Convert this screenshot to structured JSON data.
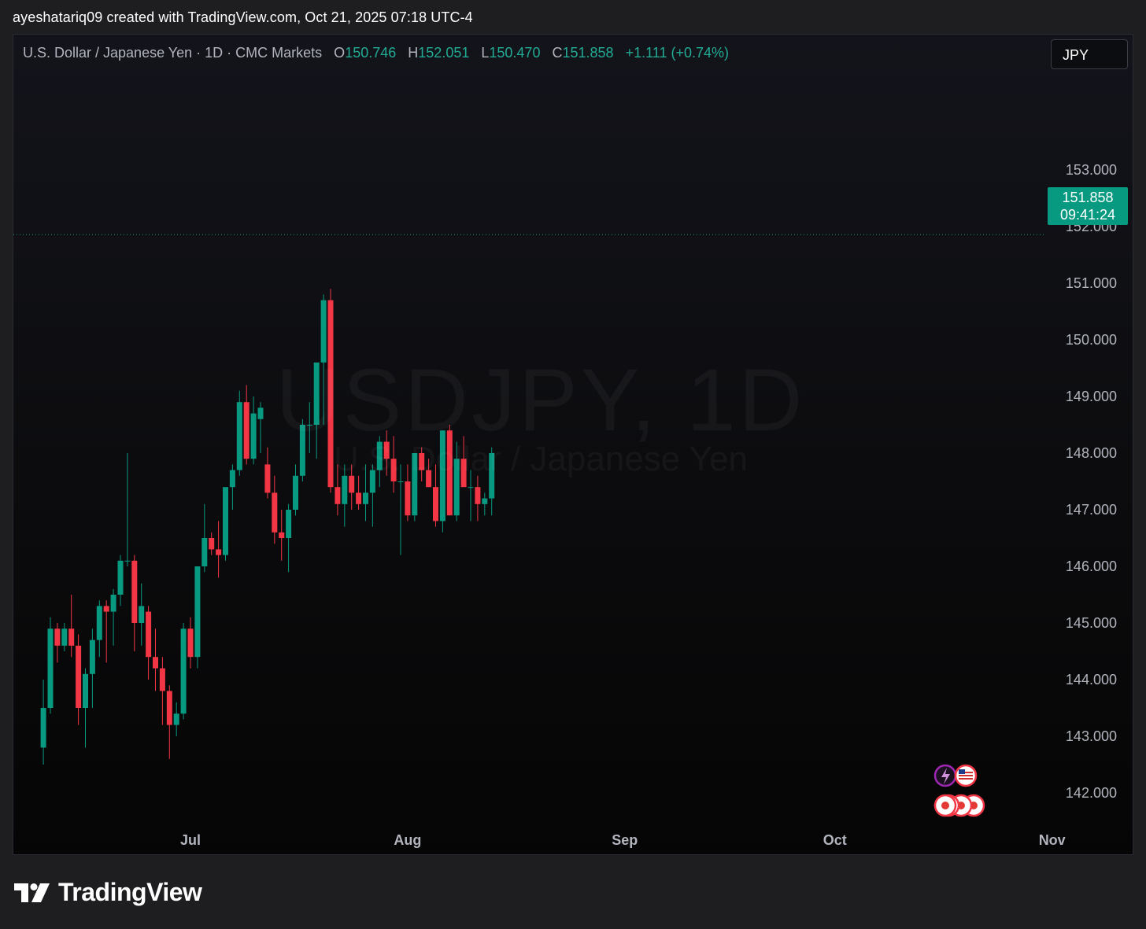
{
  "header": {
    "credit": "ayeshatariq09 created with TradingView.com, Oct 21, 2025 07:18 UTC-4"
  },
  "legend": {
    "symbol": "U.S. Dollar / Japanese Yen · 1D · CMC Markets",
    "open_label": "O",
    "open": "150.746",
    "high_label": "H",
    "high": "152.051",
    "low_label": "L",
    "low": "150.470",
    "close_label": "C",
    "close": "151.858",
    "change": "+1.111 (+0.74%)"
  },
  "currency_button": {
    "label": "JPY"
  },
  "watermark": {
    "symbol": "USDJPY, 1D",
    "name": "U.S. Dollar / Japanese Yen"
  },
  "last_price": {
    "price": "151.858",
    "countdown": "09:41:24"
  },
  "footer": {
    "brand": "TradingView"
  },
  "colors": {
    "up": "#089981",
    "down": "#f23645",
    "background": "#0b0b0d",
    "axis_text": "#b2b5be"
  },
  "icons": [
    "lightning-event-icon",
    "us-flag-icon",
    "japan-flag-icon"
  ],
  "chart_data": {
    "type": "candlestick",
    "title": "U.S. Dollar / Japanese Yen · 1D · CMC Markets",
    "x_ticks": [
      "Jul",
      "Aug",
      "Sep",
      "Oct",
      "Nov"
    ],
    "y_ticks": [
      "142.000",
      "143.000",
      "144.000",
      "145.000",
      "146.000",
      "147.000",
      "148.000",
      "149.000",
      "150.000",
      "151.000",
      "152.000",
      "153.000"
    ],
    "ylim": [
      141.5,
      154.0
    ],
    "x_range_days": [
      -21,
      44
    ],
    "x_tick_days": [
      0,
      31,
      62,
      92,
      123
    ],
    "grid": false,
    "candles": [
      {
        "d": -21,
        "o": 142.8,
        "h": 144.0,
        "l": 142.5,
        "c": 143.5
      },
      {
        "d": -20,
        "o": 143.5,
        "h": 145.1,
        "l": 143.4,
        "c": 144.9
      },
      {
        "d": -19,
        "o": 144.9,
        "h": 145.0,
        "l": 144.3,
        "c": 144.6
      },
      {
        "d": -18,
        "o": 144.6,
        "h": 145.0,
        "l": 144.5,
        "c": 144.9
      },
      {
        "d": -17,
        "o": 144.9,
        "h": 145.5,
        "l": 144.4,
        "c": 144.6
      },
      {
        "d": -16,
        "o": 144.6,
        "h": 144.8,
        "l": 143.2,
        "c": 143.5
      },
      {
        "d": -15,
        "o": 143.5,
        "h": 144.2,
        "l": 142.8,
        "c": 144.1
      },
      {
        "d": -14,
        "o": 144.1,
        "h": 144.9,
        "l": 143.5,
        "c": 144.7
      },
      {
        "d": -13,
        "o": 144.7,
        "h": 145.4,
        "l": 144.4,
        "c": 145.3
      },
      {
        "d": -12,
        "o": 145.3,
        "h": 145.4,
        "l": 144.3,
        "c": 145.2
      },
      {
        "d": -11,
        "o": 145.2,
        "h": 145.6,
        "l": 144.6,
        "c": 145.5
      },
      {
        "d": -10,
        "o": 145.5,
        "h": 146.2,
        "l": 145.3,
        "c": 146.1
      },
      {
        "d": -9,
        "o": 146.1,
        "h": 148.0,
        "l": 146.0,
        "c": 146.1
      },
      {
        "d": -8,
        "o": 146.1,
        "h": 146.2,
        "l": 144.5,
        "c": 145.0
      },
      {
        "d": -7,
        "o": 145.0,
        "h": 145.7,
        "l": 144.6,
        "c": 145.3
      },
      {
        "d": -6,
        "o": 145.2,
        "h": 145.3,
        "l": 144.0,
        "c": 144.4
      },
      {
        "d": -5,
        "o": 144.4,
        "h": 144.9,
        "l": 143.8,
        "c": 144.2
      },
      {
        "d": -4,
        "o": 144.2,
        "h": 144.4,
        "l": 143.2,
        "c": 143.8
      },
      {
        "d": -3,
        "o": 143.8,
        "h": 143.9,
        "l": 142.6,
        "c": 143.2
      },
      {
        "d": -2,
        "o": 143.2,
        "h": 143.6,
        "l": 143.0,
        "c": 143.4
      },
      {
        "d": -1,
        "o": 143.4,
        "h": 145.0,
        "l": 143.3,
        "c": 144.9
      },
      {
        "d": 0,
        "o": 144.9,
        "h": 145.1,
        "l": 144.2,
        "c": 144.4
      },
      {
        "d": 1,
        "o": 144.4,
        "h": 146.0,
        "l": 144.2,
        "c": 146.0
      },
      {
        "d": 2,
        "o": 146.0,
        "h": 147.1,
        "l": 145.9,
        "c": 146.5
      },
      {
        "d": 3,
        "o": 146.5,
        "h": 146.6,
        "l": 146.2,
        "c": 146.3
      },
      {
        "d": 4,
        "o": 146.3,
        "h": 146.8,
        "l": 145.8,
        "c": 146.2
      },
      {
        "d": 5,
        "o": 146.2,
        "h": 147.4,
        "l": 146.1,
        "c": 147.4
      },
      {
        "d": 6,
        "o": 147.4,
        "h": 147.8,
        "l": 147.0,
        "c": 147.7
      },
      {
        "d": 7,
        "o": 147.7,
        "h": 149.1,
        "l": 147.6,
        "c": 148.9
      },
      {
        "d": 8,
        "o": 148.9,
        "h": 149.2,
        "l": 147.8,
        "c": 147.9
      },
      {
        "d": 9,
        "o": 147.9,
        "h": 149.0,
        "l": 147.8,
        "c": 148.7
      },
      {
        "d": 10,
        "o": 148.6,
        "h": 148.9,
        "l": 148.0,
        "c": 148.8
      },
      {
        "d": 11,
        "o": 147.8,
        "h": 148.1,
        "l": 147.2,
        "c": 147.3
      },
      {
        "d": 12,
        "o": 147.3,
        "h": 147.6,
        "l": 146.4,
        "c": 146.6
      },
      {
        "d": 13,
        "o": 146.6,
        "h": 147.0,
        "l": 146.1,
        "c": 146.5
      },
      {
        "d": 14,
        "o": 146.5,
        "h": 147.1,
        "l": 145.9,
        "c": 147.0
      },
      {
        "d": 15,
        "o": 147.0,
        "h": 147.8,
        "l": 146.9,
        "c": 147.6
      },
      {
        "d": 16,
        "o": 147.6,
        "h": 148.6,
        "l": 147.5,
        "c": 148.5
      },
      {
        "d": 17,
        "o": 148.5,
        "h": 148.9,
        "l": 148.0,
        "c": 148.5
      },
      {
        "d": 18,
        "o": 148.5,
        "h": 149.0,
        "l": 147.9,
        "c": 149.6
      },
      {
        "d": 19,
        "o": 149.6,
        "h": 150.8,
        "l": 148.5,
        "c": 150.7
      },
      {
        "d": 20,
        "o": 150.7,
        "h": 150.9,
        "l": 147.3,
        "c": 147.4
      },
      {
        "d": 21,
        "o": 147.4,
        "h": 147.8,
        "l": 146.9,
        "c": 147.1
      },
      {
        "d": 22,
        "o": 147.1,
        "h": 147.8,
        "l": 146.7,
        "c": 147.6
      },
      {
        "d": 23,
        "o": 147.6,
        "h": 147.8,
        "l": 147.0,
        "c": 147.3
      },
      {
        "d": 24,
        "o": 147.3,
        "h": 147.6,
        "l": 147.0,
        "c": 147.1
      },
      {
        "d": 25,
        "o": 147.1,
        "h": 147.8,
        "l": 146.8,
        "c": 147.3
      },
      {
        "d": 26,
        "o": 147.3,
        "h": 147.8,
        "l": 146.7,
        "c": 147.7
      },
      {
        "d": 27,
        "o": 147.7,
        "h": 148.3,
        "l": 147.4,
        "c": 148.2
      },
      {
        "d": 28,
        "o": 148.2,
        "h": 148.4,
        "l": 147.6,
        "c": 147.9
      },
      {
        "d": 29,
        "o": 147.9,
        "h": 148.3,
        "l": 147.3,
        "c": 147.5
      },
      {
        "d": 30,
        "o": 147.5,
        "h": 147.8,
        "l": 146.2,
        "c": 147.5
      },
      {
        "d": 31,
        "o": 147.5,
        "h": 147.8,
        "l": 146.8,
        "c": 146.9
      },
      {
        "d": 32,
        "o": 146.9,
        "h": 148.0,
        "l": 146.8,
        "c": 148.0
      },
      {
        "d": 33,
        "o": 148.0,
        "h": 148.1,
        "l": 147.5,
        "c": 147.7
      },
      {
        "d": 34,
        "o": 147.7,
        "h": 147.9,
        "l": 147.4,
        "c": 147.4
      },
      {
        "d": 35,
        "o": 147.4,
        "h": 147.8,
        "l": 146.7,
        "c": 146.8
      },
      {
        "d": 36,
        "o": 146.8,
        "h": 148.4,
        "l": 146.6,
        "c": 148.4
      },
      {
        "d": 37,
        "o": 148.4,
        "h": 148.5,
        "l": 146.9,
        "c": 146.9
      },
      {
        "d": 38,
        "o": 146.9,
        "h": 148.2,
        "l": 146.8,
        "c": 147.9
      },
      {
        "d": 39,
        "o": 147.9,
        "h": 148.3,
        "l": 147.5,
        "c": 147.4
      },
      {
        "d": 40,
        "o": 147.4,
        "h": 147.7,
        "l": 146.8,
        "c": 147.4
      },
      {
        "d": 41,
        "o": 147.4,
        "h": 147.6,
        "l": 146.8,
        "c": 147.1
      },
      {
        "d": 42,
        "o": 147.1,
        "h": 147.3,
        "l": 146.9,
        "c": 147.2
      },
      {
        "d": 43,
        "o": 147.2,
        "h": 148.1,
        "l": 146.9,
        "c": 148.0
      }
    ]
  }
}
